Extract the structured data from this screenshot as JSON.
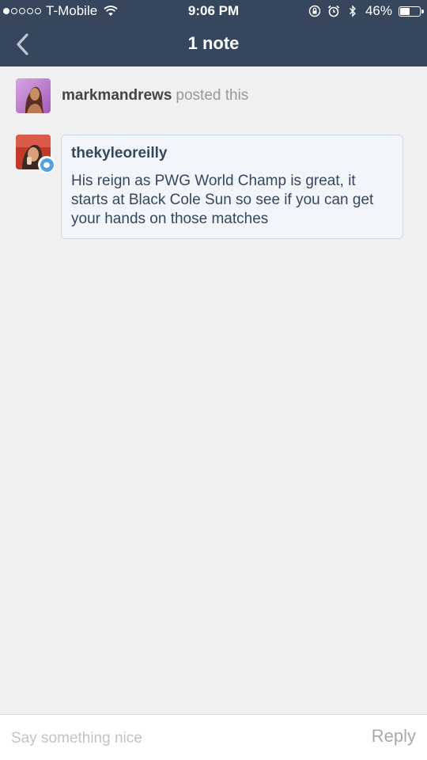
{
  "status_bar": {
    "carrier": "T-Mobile",
    "time": "9:06 PM",
    "battery_percent": "46%",
    "battery_level": 0.46,
    "signal_bars": 1,
    "signal_total": 5
  },
  "header": {
    "title": "1 note",
    "background_color": "#36465d"
  },
  "notes": [
    {
      "type": "post",
      "username": "markmandrews",
      "action": "posted this"
    },
    {
      "type": "reply",
      "username": "thekyleoreilly",
      "text": "His reign as PWG World Champ is great, it starts at Black Cole Sun so see if you can get your hands on those matches"
    }
  ],
  "reply_bar": {
    "placeholder": "Say something nice",
    "value": "",
    "button_label": "Reply"
  }
}
